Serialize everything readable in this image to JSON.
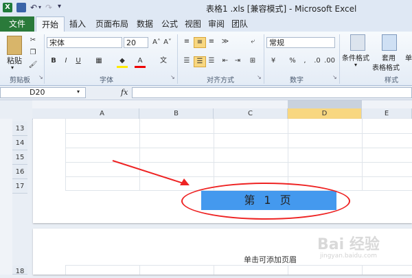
{
  "window": {
    "title": "表格1 .xls  [兼容模式] - Microsoft Excel"
  },
  "tabs": [
    {
      "label": "文件"
    },
    {
      "label": "开始"
    },
    {
      "label": "插入"
    },
    {
      "label": "页面布局"
    },
    {
      "label": "数据"
    },
    {
      "label": "公式"
    },
    {
      "label": "视图"
    },
    {
      "label": "审阅"
    },
    {
      "label": "团队"
    }
  ],
  "ribbon": {
    "clipboard": {
      "paste": "粘贴",
      "label": "剪贴板"
    },
    "font": {
      "family": "宋体",
      "size": "20",
      "label": "字体"
    },
    "alignment": {
      "label": "对齐方式"
    },
    "number": {
      "format": "常规",
      "label": "数字",
      "percent": "%",
      "comma": ","
    },
    "styles": {
      "conditional": "条件格式",
      "table_format_line1": "套用",
      "table_format_line2": "表格格式",
      "label": "样式",
      "cell_styles": "单"
    }
  },
  "formula_bar": {
    "name_box": "D20",
    "fx": "fx"
  },
  "columns": [
    "A",
    "B",
    "C",
    "D",
    "E"
  ],
  "selected_column": "D",
  "rows": [
    "13",
    "14",
    "15",
    "16",
    "17",
    "18"
  ],
  "page_banner": "第 1 页",
  "header_hint": "单击可添加页眉",
  "watermark": {
    "text": "Bai 经验",
    "sub": "jingyan.baidu.com"
  },
  "colors": {
    "file_tab": "#2a7a3a",
    "banner": "#4499ee",
    "highlight": "#e22222",
    "selected_column": "#f8d780"
  }
}
